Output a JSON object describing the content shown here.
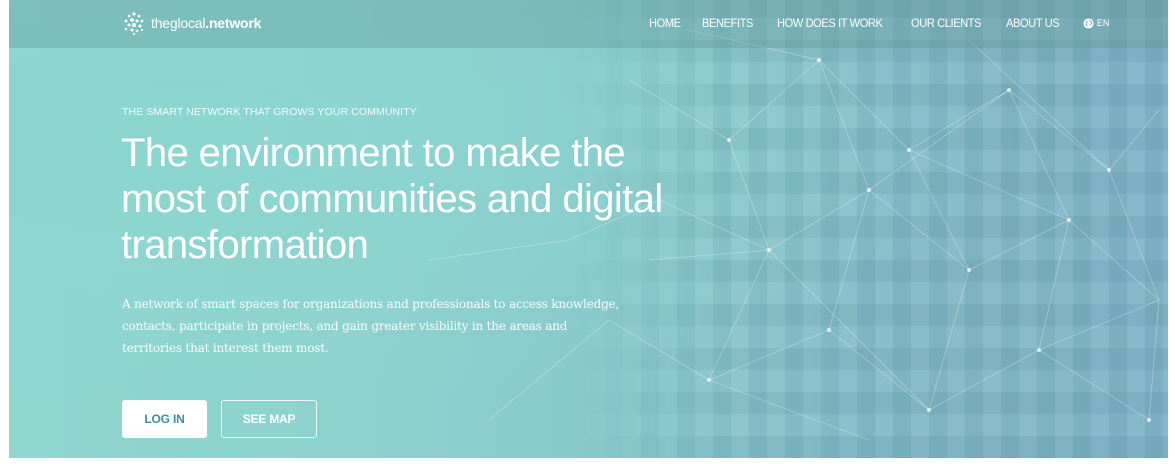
{
  "header": {
    "logo_text_light": "theglocal",
    "logo_text_bold": ".network",
    "nav": [
      "HOME",
      "BENEFITS",
      "HOW DOES IT WORK",
      "OUR CLIENTS",
      "ABOUT US"
    ],
    "language": "EN"
  },
  "hero": {
    "tagline": "THE SMART NETWORK THAT GROWS YOUR COMMUNITY",
    "headline": "The environment to make the most of communities and digital transformation",
    "description": "A network of smart spaces for organizations and professionals to access knowledge, contacts, participate in projects, and gain greater visibility in the areas and territories that interest them most.",
    "login_label": "LOG IN",
    "map_label": "SEE MAP"
  },
  "colors": {
    "hero_teal": "#8fd6cf",
    "hero_blue": "#7bb2c5",
    "login_text": "#3f8ca0"
  }
}
